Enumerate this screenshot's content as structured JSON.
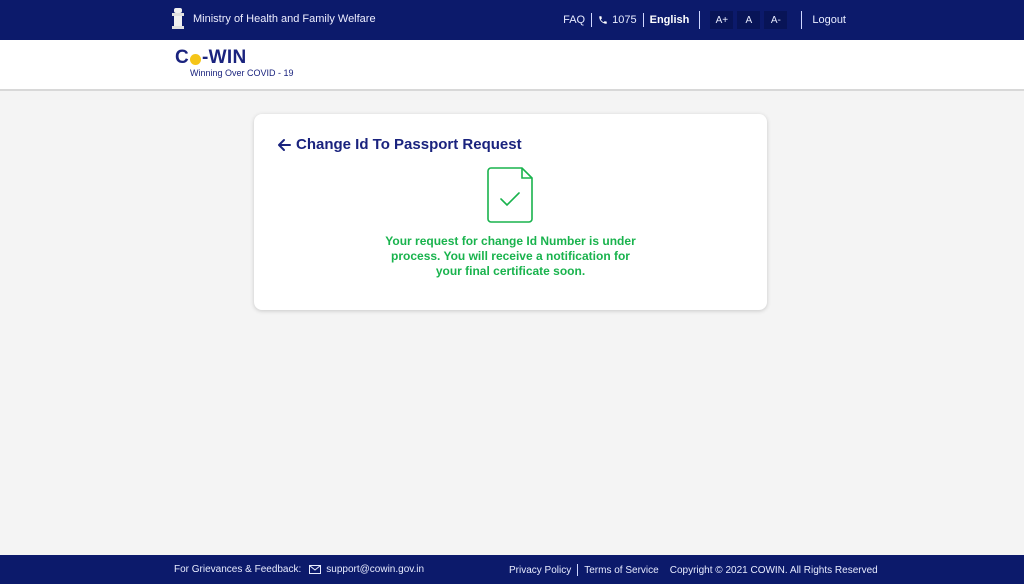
{
  "header": {
    "ministry": "Ministry of Health and Family Welfare",
    "faq": "FAQ",
    "helpline": "1075",
    "language": "English",
    "font_increase": "A+",
    "font_normal": "A",
    "font_decrease": "A-",
    "logout": "Logout"
  },
  "brand": {
    "logo_prefix": "C",
    "logo_suffix": "-WIN",
    "tagline": "Winning Over COVID - 19"
  },
  "card": {
    "title": "Change Id To Passport Request",
    "message_lines": [
      "Your request for change Id Number is under",
      "process. You will receive a notification for",
      "your final certificate soon."
    ]
  },
  "footer": {
    "grievance_label": "For Grievances & Feedback:",
    "email": "support@cowin.gov.in",
    "privacy": "Privacy Policy",
    "terms": "Terms of Service",
    "copyright": "Copyright © 2021 COWIN. All Rights Reserved"
  },
  "colors": {
    "primary_navy": "#0c1a6b",
    "title_navy": "#1a237e",
    "success_green": "#19b34d",
    "background": "#f4f4f4"
  }
}
